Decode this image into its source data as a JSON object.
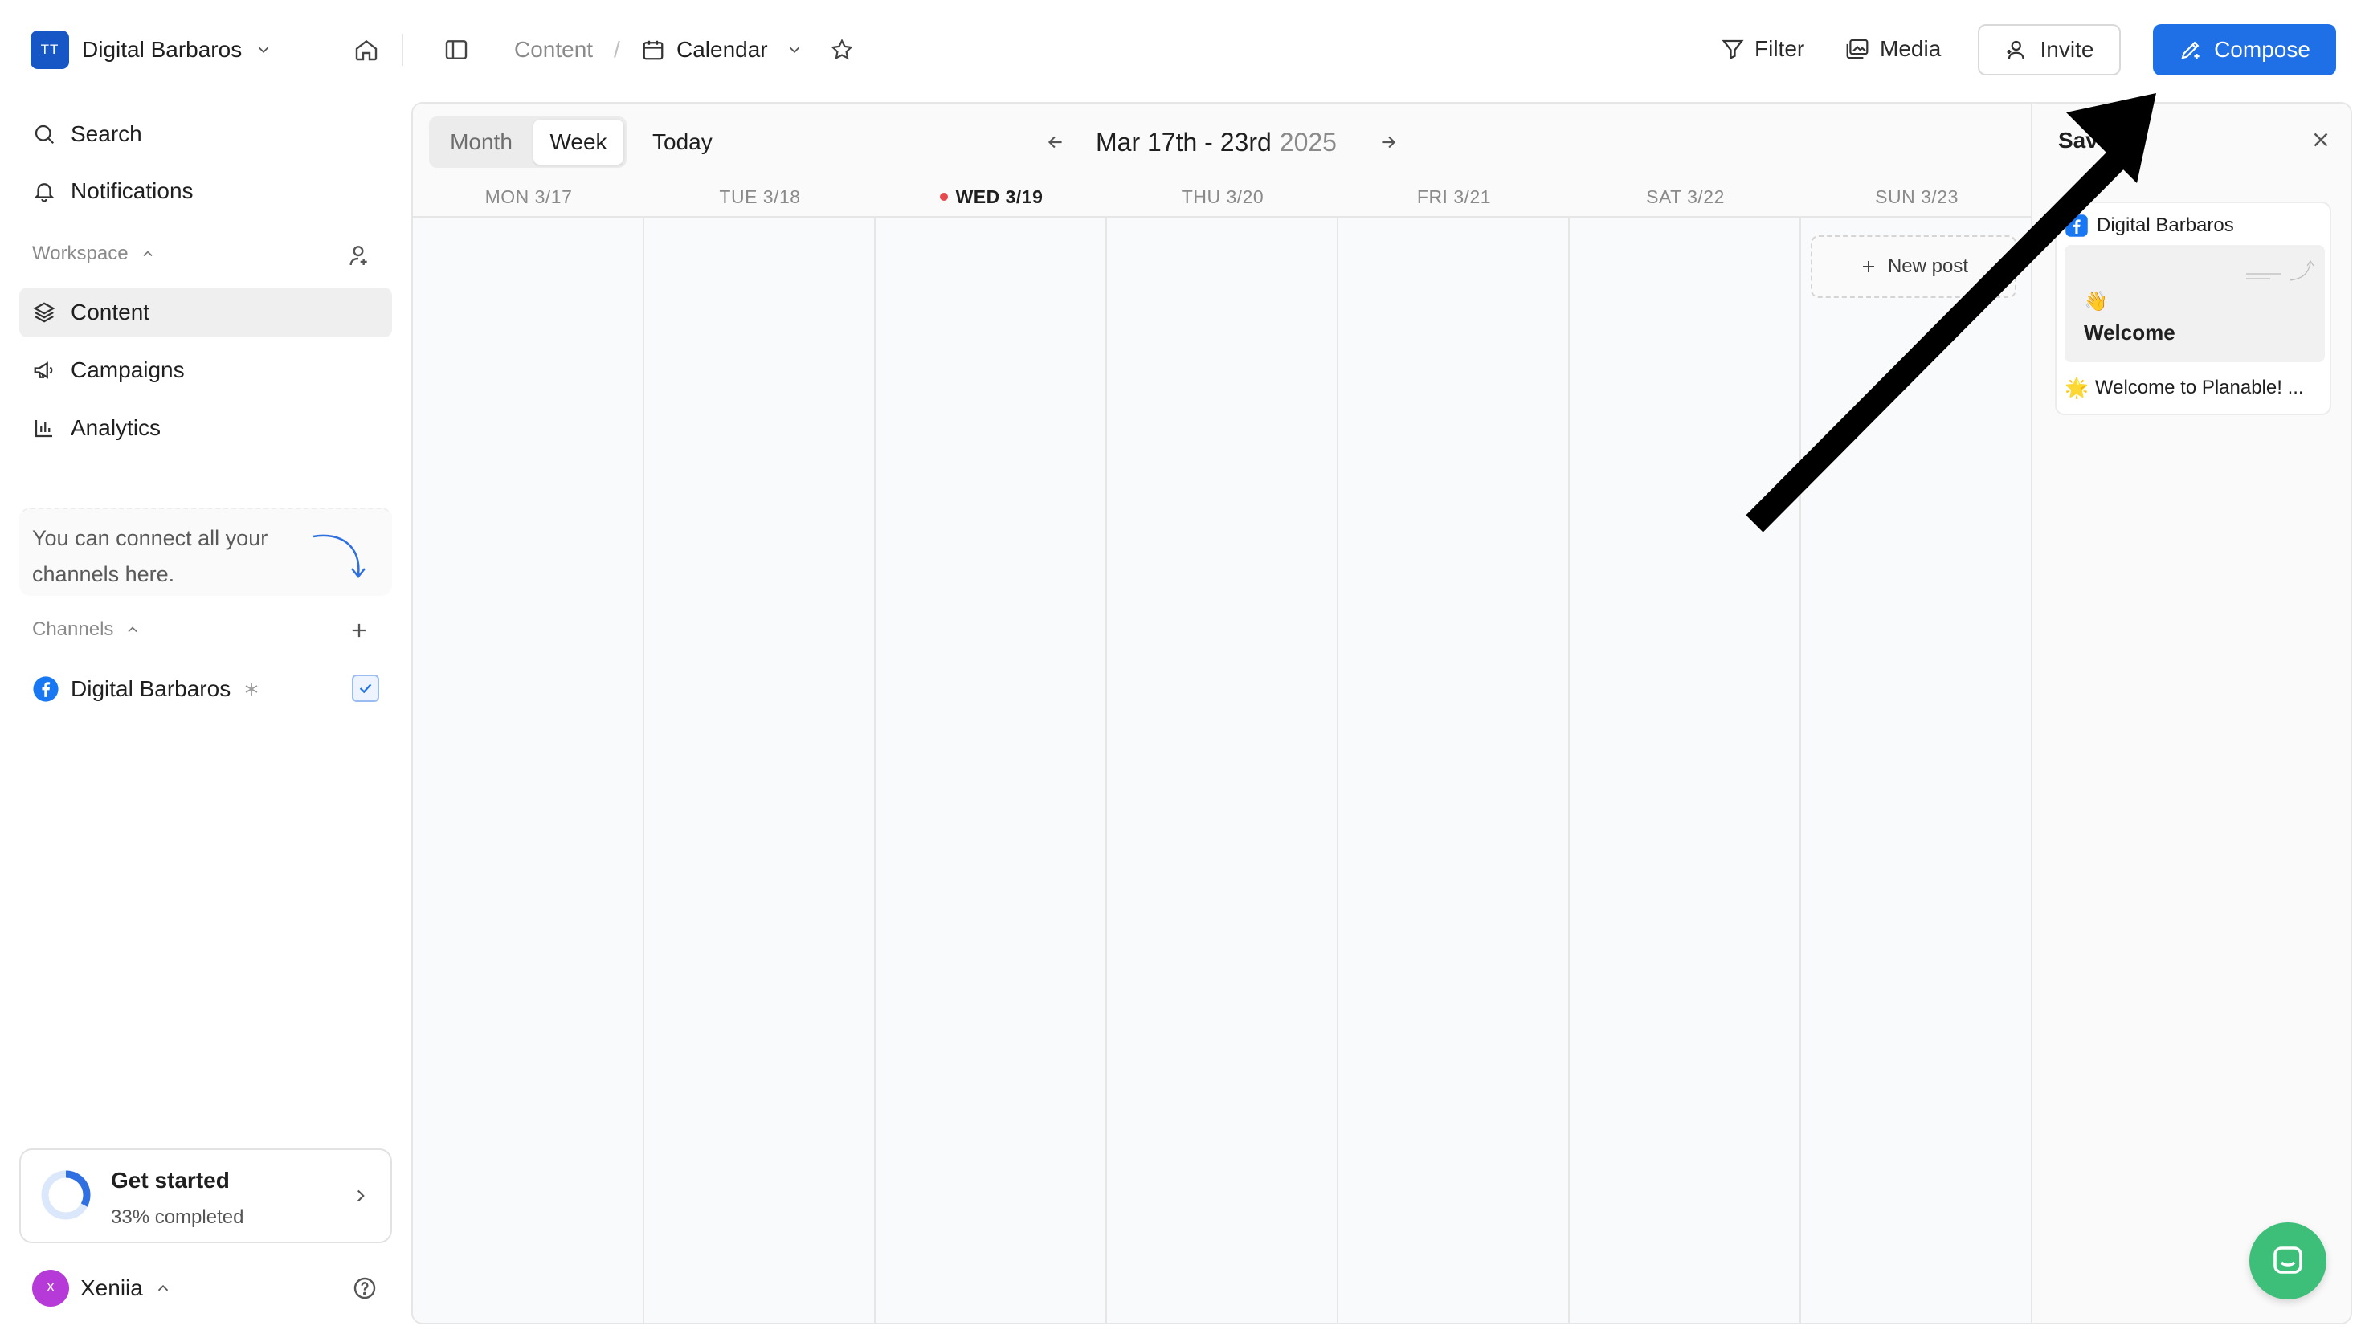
{
  "header": {
    "workspace_logo": "TT",
    "workspace_name": "Digital Barbaros",
    "breadcrumb_content": "Content",
    "breadcrumb_sep": "/",
    "breadcrumb_calendar": "Calendar",
    "filter_label": "Filter",
    "media_label": "Media",
    "invite_label": "Invite",
    "compose_label": "Compose"
  },
  "sidebar": {
    "search": "Search",
    "notifications": "Notifications",
    "workspace_section": "Workspace",
    "items": [
      {
        "label": "Content",
        "icon": "layers-icon"
      },
      {
        "label": "Campaigns",
        "icon": "megaphone-icon"
      },
      {
        "label": "Analytics",
        "icon": "bar-chart-icon"
      }
    ],
    "hint_text": "You can connect all your channels here.",
    "channels_section": "Channels",
    "channel_name": "Digital Barbaros",
    "get_started_title": "Get started",
    "get_started_sub": "33% completed",
    "get_started_progress": 0.33,
    "user_initial": "X",
    "user_name": "Xeniia"
  },
  "calendar": {
    "view_month": "Month",
    "view_week": "Week",
    "today": "Today",
    "range_main": "Mar 17th - 23rd",
    "range_year": "2025",
    "days": [
      "MON 3/17",
      "TUE 3/18",
      "WED 3/19",
      "THU 3/20",
      "FRI 3/21",
      "SAT 3/22",
      "SUN 3/23"
    ],
    "today_index": 2,
    "new_post": "New post"
  },
  "panel": {
    "title": "Sav",
    "card_channel": "Digital Barbaros",
    "card_emoji": "👋",
    "card_title": "Welcome",
    "card_caption_emoji": "🌟",
    "card_caption": "Welcome to Planable! ..."
  },
  "colors": {
    "accent": "#1f6fe6",
    "brand_logo": "#1657c5",
    "facebook": "#1877f2",
    "chat": "#3dbf7a",
    "today_dot": "#e5484d"
  }
}
